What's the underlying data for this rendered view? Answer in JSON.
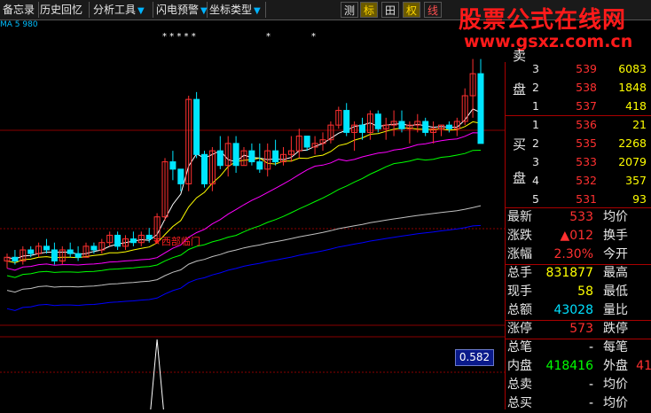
{
  "toolbar": {
    "items": [
      {
        "label": "备忘录"
      },
      {
        "label": "历史回忆"
      },
      {
        "label": "分析工具",
        "arrow": "▼"
      },
      {
        "label": "闪电预警",
        "arrow": "▼"
      },
      {
        "label": "坐标类型",
        "arrow": "▼"
      }
    ],
    "buttons": [
      {
        "label": "测"
      },
      {
        "label": "标"
      },
      {
        "label": "田"
      },
      {
        "label": "权"
      },
      {
        "label": "线"
      }
    ]
  },
  "brand": {
    "title": "股票公式在线网",
    "url": "www.gsxz.com.cn"
  },
  "chart": {
    "info": "MA  5  980",
    "stars": [
      "* * * * *",
      "*",
      "*"
    ],
    "annotation": "★西部临门",
    "indicator_value": "0.582"
  },
  "chart_data": {
    "type": "candlestick",
    "candles": [
      [
        501,
        503,
        499,
        502
      ],
      [
        502,
        504,
        500,
        501
      ],
      [
        501,
        505,
        500,
        504
      ],
      [
        504,
        505,
        502,
        503
      ],
      [
        503,
        506,
        502,
        505
      ],
      [
        505,
        507,
        503,
        504
      ],
      [
        504,
        506,
        500,
        501
      ],
      [
        501,
        505,
        500,
        504
      ],
      [
        504,
        506,
        502,
        503
      ],
      [
        503,
        505,
        501,
        502
      ],
      [
        502,
        506,
        502,
        505
      ],
      [
        505,
        506,
        503,
        504
      ],
      [
        504,
        507,
        503,
        506
      ],
      [
        506,
        509,
        505,
        508
      ],
      [
        508,
        509,
        504,
        505
      ],
      [
        505,
        508,
        504,
        507
      ],
      [
        507,
        509,
        505,
        506
      ],
      [
        506,
        509,
        505,
        508
      ],
      [
        508,
        510,
        506,
        507
      ],
      [
        507,
        514,
        506,
        513
      ],
      [
        513,
        529,
        512,
        528
      ],
      [
        528,
        531,
        523,
        526
      ],
      [
        526,
        526,
        520,
        522
      ],
      [
        522,
        546,
        520,
        545
      ],
      [
        545,
        547,
        529,
        530
      ],
      [
        530,
        531,
        521,
        522
      ],
      [
        522,
        532,
        520,
        531
      ],
      [
        531,
        535,
        526,
        527
      ],
      [
        527,
        535,
        524,
        533
      ],
      [
        533,
        535,
        525,
        527
      ],
      [
        527,
        532,
        527,
        531
      ],
      [
        531,
        533,
        527,
        528
      ],
      [
        528,
        533,
        525,
        526
      ],
      [
        526,
        533,
        524,
        531
      ],
      [
        531,
        534,
        527,
        528
      ],
      [
        528,
        532,
        527,
        530
      ],
      [
        530,
        535,
        528,
        531
      ],
      [
        531,
        537,
        529,
        535
      ],
      [
        535,
        535,
        531,
        532
      ],
      [
        532,
        535,
        530,
        533
      ],
      [
        533,
        536,
        531,
        534
      ],
      [
        534,
        539,
        533,
        538
      ],
      [
        538,
        543,
        537,
        542
      ],
      [
        542,
        544,
        535,
        536
      ],
      [
        536,
        539,
        531,
        538
      ],
      [
        538,
        540,
        534,
        536
      ],
      [
        536,
        542,
        534,
        541
      ],
      [
        541,
        542,
        536,
        537
      ],
      [
        537,
        540,
        534,
        538
      ],
      [
        538,
        542,
        535,
        539
      ],
      [
        539,
        542,
        536,
        537
      ],
      [
        537,
        539,
        533,
        538
      ],
      [
        538,
        541,
        536,
        539
      ],
      [
        539,
        540,
        535,
        536
      ],
      [
        536,
        539,
        533,
        537
      ],
      [
        537,
        538,
        535,
        538
      ],
      [
        538,
        539,
        536,
        537
      ],
      [
        537,
        540,
        535,
        539
      ],
      [
        539,
        548,
        538,
        546
      ],
      [
        546,
        556,
        540,
        552
      ],
      [
        552,
        556,
        533,
        533
      ]
    ],
    "ma_colors": {
      "ma5": "#ffffff",
      "ma10": "#ffff00",
      "ma20": "#ff00ff",
      "ma30": "#00ff00",
      "ma60": "#c0c0c0",
      "ma120": "#0000ff"
    }
  },
  "orders": {
    "sell_label": "盘",
    "sell_label_top": "卖",
    "buy_label_top": "买",
    "buy_label_bottom": "盘",
    "sell": [
      {
        "level": "3",
        "price": "539",
        "vol": "6083"
      },
      {
        "level": "2",
        "price": "538",
        "vol": "1848"
      },
      {
        "level": "1",
        "price": "537",
        "vol": "418"
      }
    ],
    "buy": [
      {
        "level": "1",
        "price": "536",
        "vol": "21"
      },
      {
        "level": "2",
        "price": "535",
        "vol": "2268"
      },
      {
        "level": "3",
        "price": "533",
        "vol": "2079"
      },
      {
        "level": "4",
        "price": "532",
        "vol": "357"
      },
      {
        "level": "5",
        "price": "531",
        "vol": "93"
      }
    ]
  },
  "quote": [
    {
      "k": "最新",
      "v": "533",
      "vc": "#ff3030",
      "k2": "均价",
      "v2": "",
      "v2c": "#ffffff"
    },
    {
      "k": "涨跌",
      "v": "▲012",
      "vc": "#ff3030",
      "k2": "换手",
      "v2": "",
      "v2c": "#ffffff"
    },
    {
      "k": "涨幅",
      "v": "2.30%",
      "vc": "#ff3030",
      "k2": "今开",
      "v2": "",
      "v2c": "#ffffff"
    },
    {
      "k": "总手",
      "v": "831877",
      "vc": "#ffff00",
      "k2": "最高",
      "v2": "",
      "v2c": "#ffffff"
    },
    {
      "k": "现手",
      "v": "58",
      "vc": "#ffff00",
      "k2": "最低",
      "v2": "",
      "v2c": "#ffffff"
    },
    {
      "k": "总额",
      "v": "43028",
      "vc": "#00e0ff",
      "k2": "量比",
      "v2": "",
      "v2c": "#ffffff"
    },
    {
      "k": "涨停",
      "v": "573",
      "vc": "#ff3030",
      "k2": "跌停",
      "v2": "",
      "v2c": "#ffffff"
    },
    {
      "k": "总笔",
      "v": "-",
      "vc": "#ffffff",
      "k2": "每笔",
      "v2": "",
      "v2c": "#ffffff"
    },
    {
      "k": "内盘",
      "v": "418416",
      "vc": "#00ff00",
      "k2": "外盘",
      "v2": "41",
      "v2c": "#ff3030"
    },
    {
      "k": "总卖",
      "v": "-",
      "vc": "#ffffff",
      "k2": "均价",
      "v2": "",
      "v2c": "#ffffff"
    },
    {
      "k": "总买",
      "v": "-",
      "vc": "#ffffff",
      "k2": "均价",
      "v2": "",
      "v2c": "#ffffff"
    }
  ]
}
